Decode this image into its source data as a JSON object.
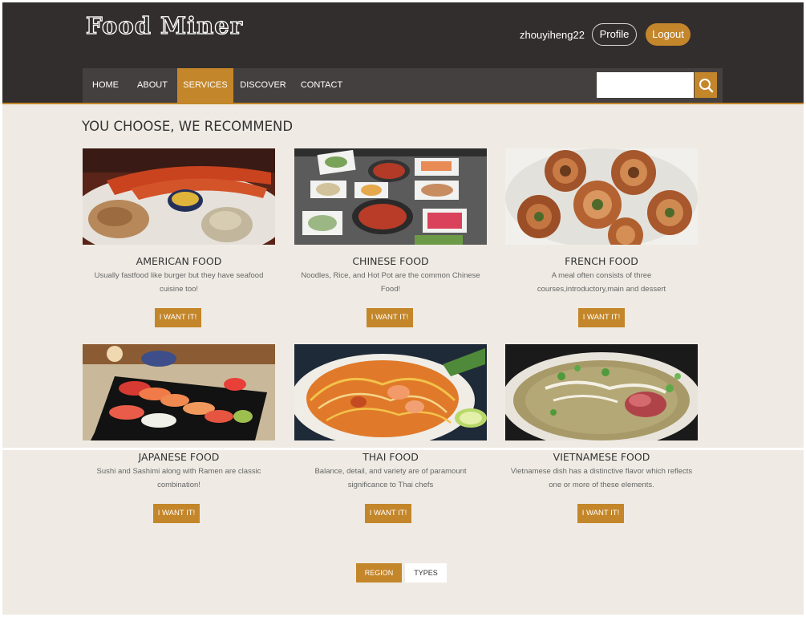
{
  "app": {
    "logo": "Food Miner"
  },
  "header": {
    "username": "zhouyiheng22",
    "profile_label": "Profile",
    "logout_label": "Logout"
  },
  "nav": {
    "items": [
      {
        "label": "HOME"
      },
      {
        "label": "ABOUT"
      },
      {
        "label": "SERVICES"
      },
      {
        "label": "DISCOVER"
      },
      {
        "label": "CONTACT"
      }
    ],
    "active": "SERVICES"
  },
  "search": {
    "value": "",
    "placeholder": "",
    "icon": "search-icon"
  },
  "main": {
    "title": "YOU CHOOSE, WE RECOMMEND",
    "cards": [
      {
        "name": "AMERICAN FOOD",
        "desc_line1": "Usually fastfood like burger but they have seafood",
        "desc_line2": "cuisine too!",
        "button": "I WANT IT!"
      },
      {
        "name": "CHINESE FOOD",
        "desc_line1": "Noodles, Rice, and Hot Pot are the common Chinese",
        "desc_line2": "Food!",
        "button": "I WANT IT!"
      },
      {
        "name": "FRENCH FOOD",
        "desc_line1": "A meal often consists of three",
        "desc_line2": "courses,introductory,main and dessert",
        "button": "I WANT IT!"
      },
      {
        "name": "JAPANESE FOOD",
        "desc_line1": "Sushi and Sashimi along with Ramen are classic",
        "desc_line2": "combination!",
        "button": "I WANT IT!"
      },
      {
        "name": "THAI FOOD",
        "desc_line1": "Balance, detail, and variety are of paramount",
        "desc_line2": "significance to Thai chefs",
        "button": "I WANT IT!"
      },
      {
        "name": "VIETNAMESE FOOD",
        "desc_line1": "Vietnamese dish has a distinctive flavor which reflects",
        "desc_line2": "one or more of these elements.",
        "button": "I WANT IT!"
      }
    ]
  },
  "filters": {
    "region_label": "REGION",
    "types_label": "TYPES",
    "active": "REGION"
  },
  "colors": {
    "accent": "#c4862a",
    "header_bg": "#332e2e",
    "nav_bg": "#454040",
    "page_bg": "#efebe4"
  }
}
